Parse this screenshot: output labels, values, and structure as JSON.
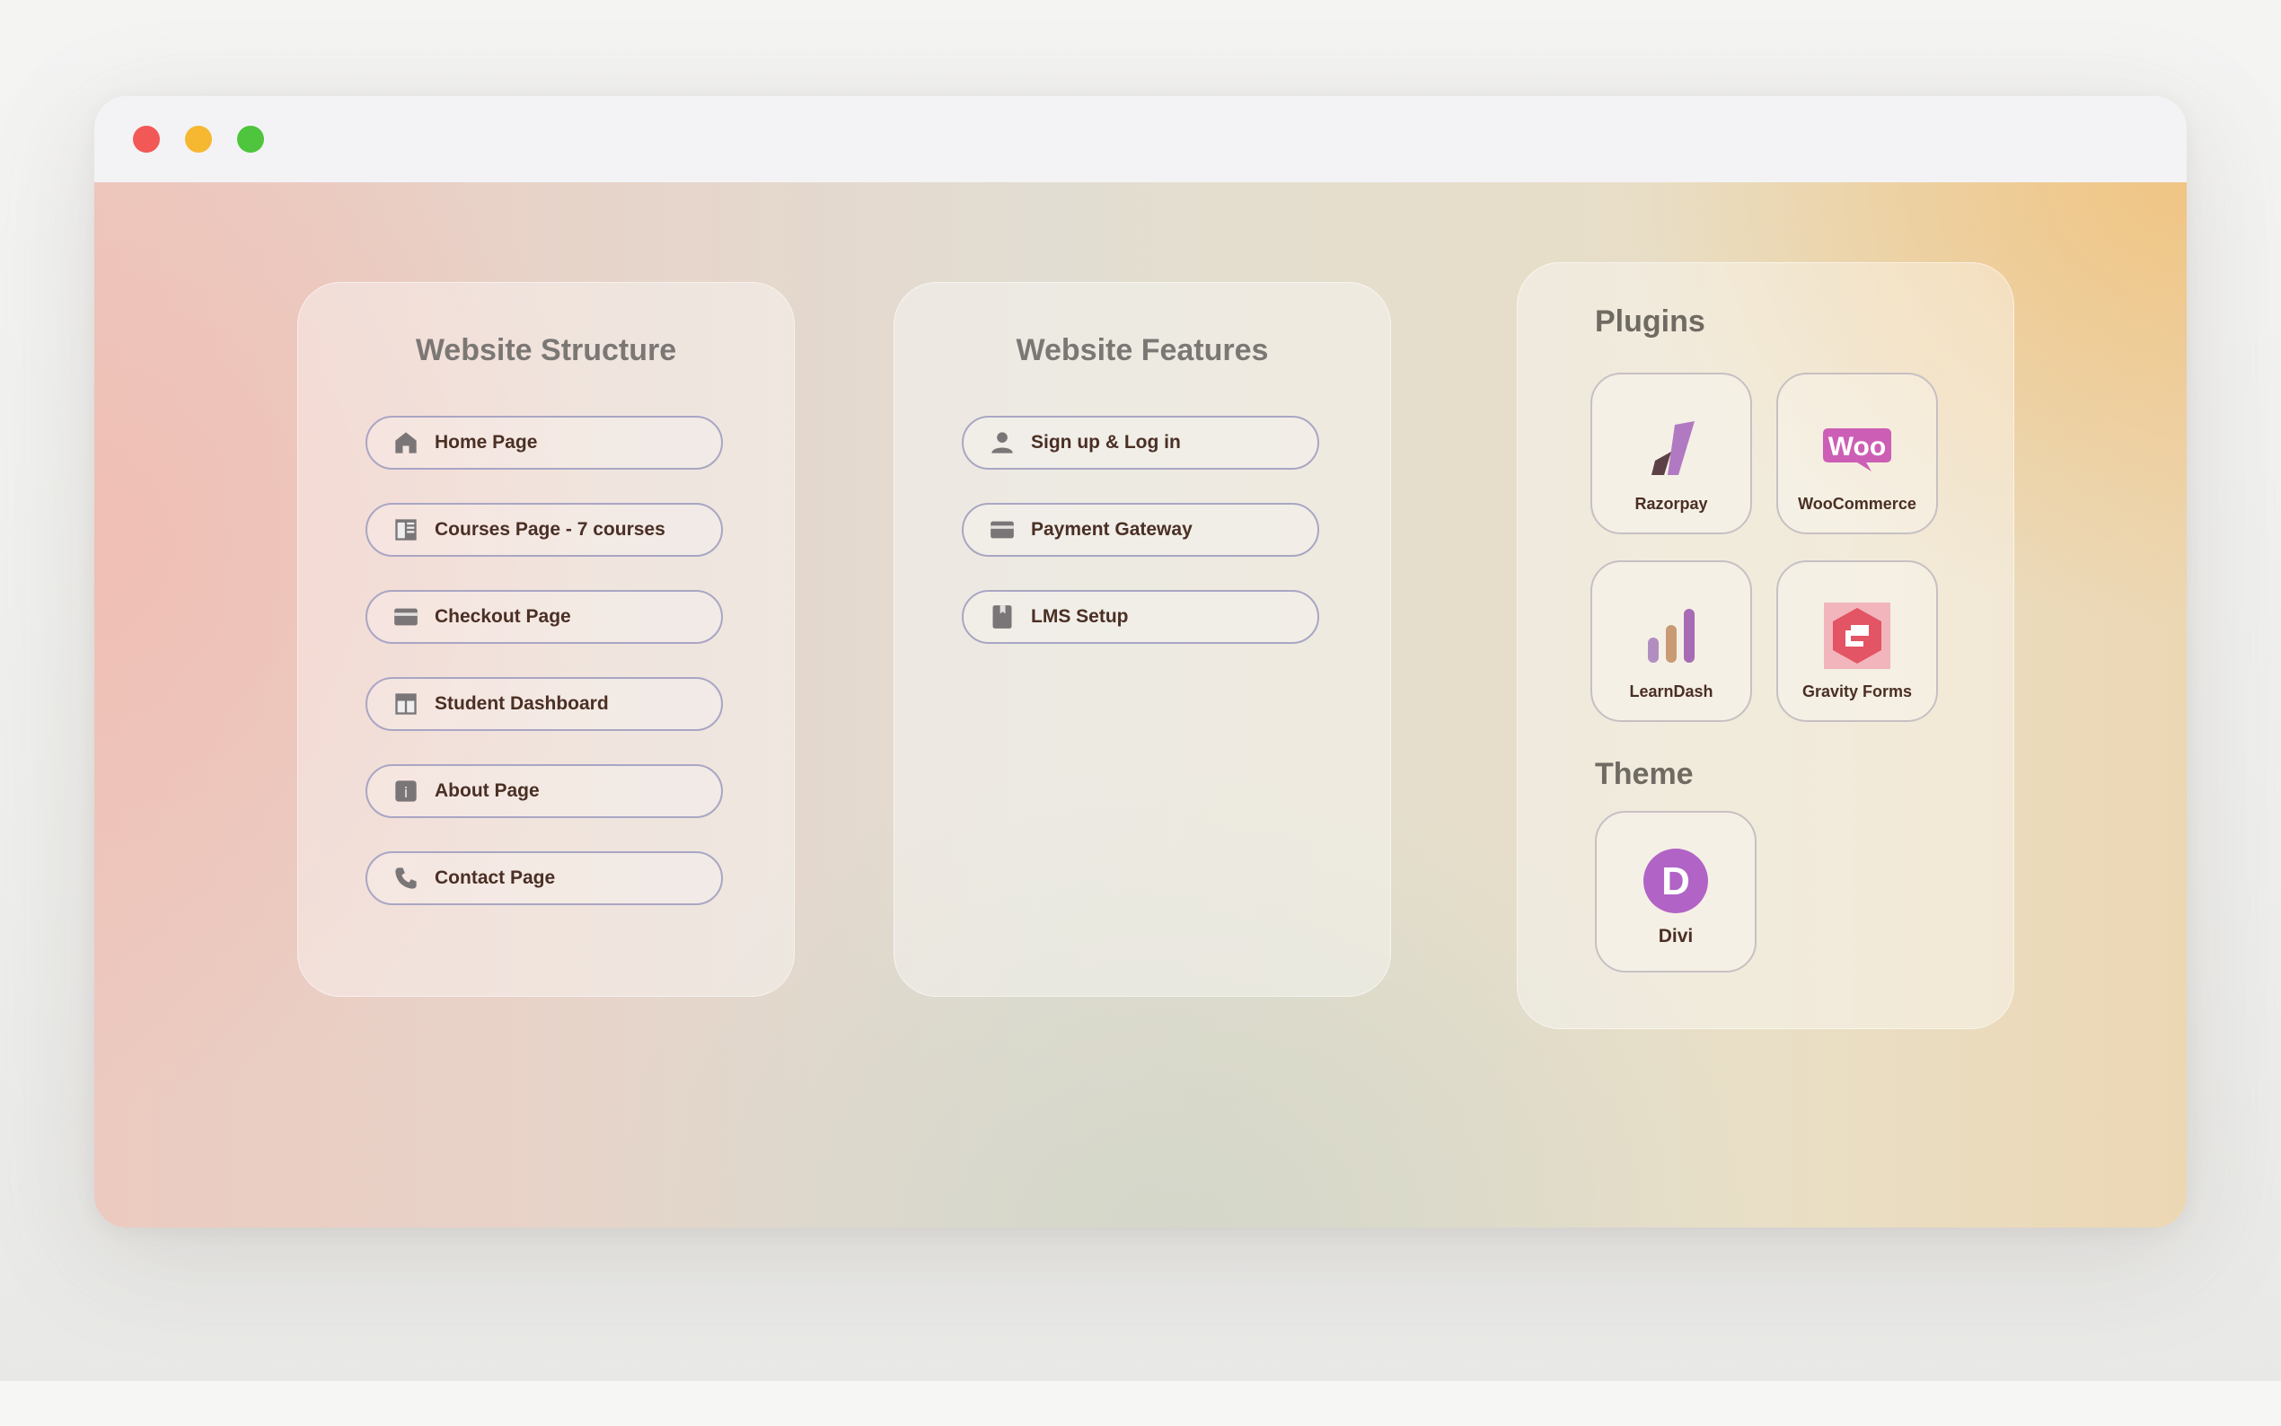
{
  "structure": {
    "title": "Website Structure",
    "items": [
      {
        "label": "Home Page",
        "icon": "home-icon"
      },
      {
        "label": "Courses Page - 7 courses",
        "icon": "courses-page-icon"
      },
      {
        "label": "Checkout Page",
        "icon": "card-icon"
      },
      {
        "label": "Student Dashboard",
        "icon": "dashboard-icon"
      },
      {
        "label": "About Page",
        "icon": "info-icon"
      },
      {
        "label": "Contact Page",
        "icon": "phone-icon"
      }
    ]
  },
  "features": {
    "title": "Website Features",
    "items": [
      {
        "label": "Sign up & Log in",
        "icon": "user-icon"
      },
      {
        "label": "Payment Gateway",
        "icon": "card-icon"
      },
      {
        "label": "LMS Setup",
        "icon": "book-icon"
      }
    ]
  },
  "plugins": {
    "title": "Plugins",
    "items": [
      {
        "label": "Razorpay",
        "icon": "razorpay-logo"
      },
      {
        "label": "WooCommerce",
        "icon": "woocommerce-logo"
      },
      {
        "label": "LearnDash",
        "icon": "learndash-logo"
      },
      {
        "label": "Gravity Forms",
        "icon": "gravity-forms-logo"
      }
    ]
  },
  "theme": {
    "title": "Theme",
    "items": [
      {
        "label": "Divi",
        "icon": "divi-logo"
      }
    ]
  },
  "logos": {
    "woo_text": "Woo",
    "divi_letter": "D",
    "info_letter": "i"
  },
  "colors": {
    "pill_border": "#a9a6c4",
    "label_text": "#4a2f24",
    "woo_pink": "#cc5eb5",
    "divi_purple": "#b163c6",
    "gravity_red": "#e35464"
  }
}
